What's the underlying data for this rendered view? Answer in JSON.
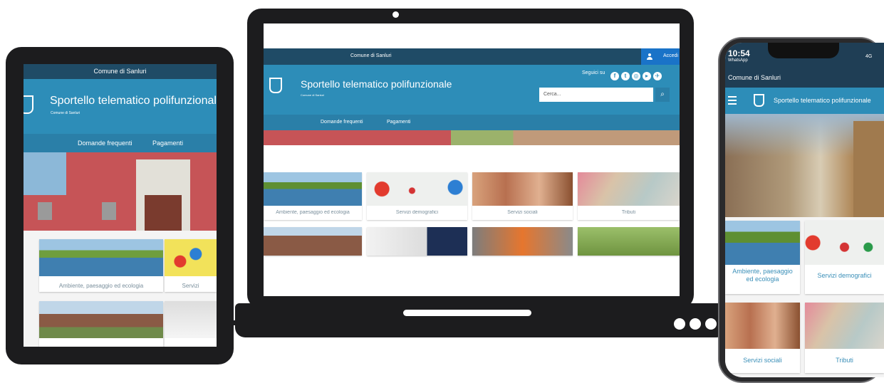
{
  "site": {
    "municipality": "Comune di Sanluri",
    "title": "Sportello telematico polifunzionale",
    "subtitle": "Comune di Sanluri",
    "login_label": "Accedi",
    "follow_label": "Seguici su",
    "search_placeholder": "Cerca...",
    "nav": [
      "Domande frequenti",
      "Pagamenti"
    ]
  },
  "laptop_cards": [
    "Ambiente, paesaggio ed ecologia",
    "Servizi demografici",
    "Servizi sociali",
    "Tributi"
  ],
  "tablet_cards": [
    "Ambiente, paesaggio ed ecologia",
    "Servizi"
  ],
  "phone": {
    "time": "10:54",
    "app_label": "WhatsApp",
    "signal": "4G",
    "cards": [
      "Ambiente, paesaggio ed ecologia",
      "Servizi demografici",
      "Servizi sociali",
      "Tributi"
    ]
  },
  "icons": [
    "facebook-icon",
    "twitter-icon",
    "instagram-icon",
    "youtube-icon",
    "telegram-icon",
    "user-icon",
    "search-icon",
    "hamburger-icon",
    "coat-of-arms-icon"
  ],
  "colors": {
    "topbar": "#1f4b66",
    "header": "#2d8db8",
    "nav": "#2a7fa8",
    "login": "#1a73c8"
  }
}
